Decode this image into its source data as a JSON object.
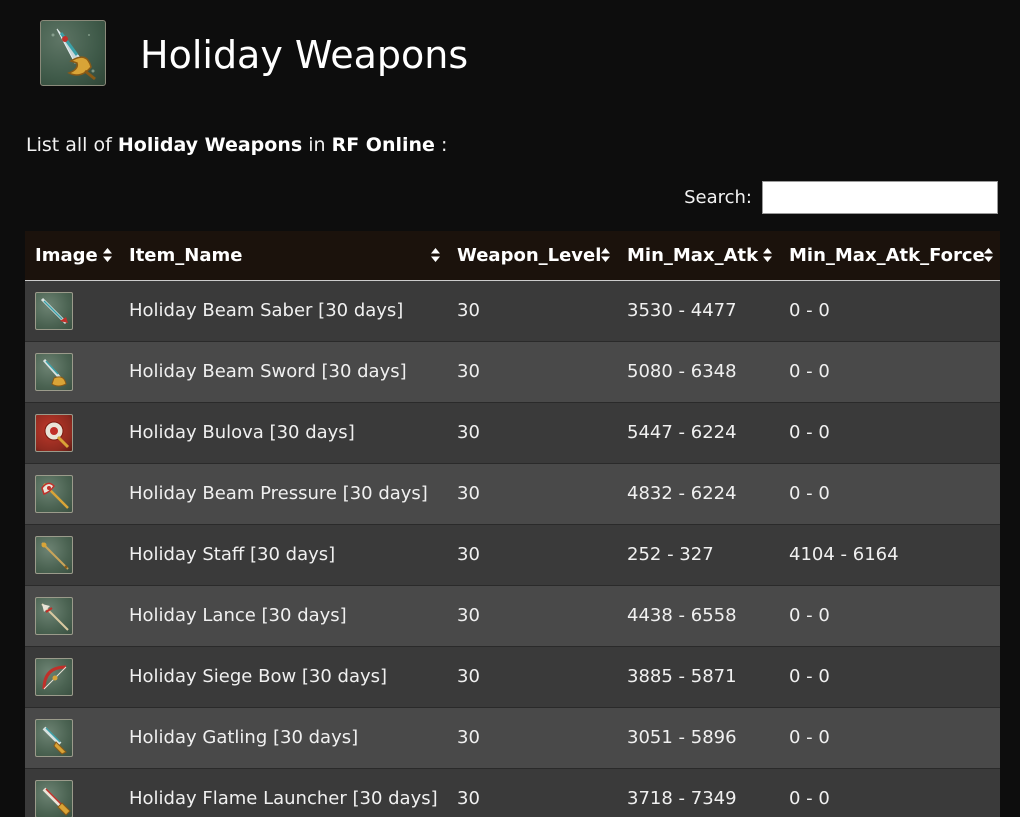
{
  "header": {
    "title": "Holiday Weapons",
    "icon": "holiday-weapon-icon"
  },
  "intro": {
    "prefix": "List all of",
    "category": "Holiday Weapons",
    "middle": "in",
    "game": "RF Online",
    "suffix": ":"
  },
  "search": {
    "label": "Search:",
    "value": ""
  },
  "table": {
    "columns": [
      "Image",
      "Item_Name",
      "Weapon_Level",
      "Min_Max_Atk",
      "Min_Max_Atk_Force"
    ],
    "rows": [
      {
        "icon": "beam-saber-icon",
        "name": "Holiday Beam Saber [30 days]",
        "level": "30",
        "atk": "3530 - 4477",
        "force": "0 - 0"
      },
      {
        "icon": "beam-sword-icon",
        "name": "Holiday Beam Sword [30 days]",
        "level": "30",
        "atk": "5080 - 6348",
        "force": "0 - 0"
      },
      {
        "icon": "bulova-icon",
        "name": "Holiday Bulova [30 days]",
        "level": "30",
        "atk": "5447 - 6224",
        "force": "0 - 0"
      },
      {
        "icon": "beam-pressure-icon",
        "name": "Holiday Beam Pressure [30 days]",
        "level": "30",
        "atk": "4832 - 6224",
        "force": "0 - 0"
      },
      {
        "icon": "staff-icon",
        "name": "Holiday Staff [30 days]",
        "level": "30",
        "atk": "252 - 327",
        "force": "4104 - 6164"
      },
      {
        "icon": "lance-icon",
        "name": "Holiday Lance [30 days]",
        "level": "30",
        "atk": "4438 - 6558",
        "force": "0 - 0"
      },
      {
        "icon": "siege-bow-icon",
        "name": "Holiday Siege Bow [30 days]",
        "level": "30",
        "atk": "3885 - 5871",
        "force": "0 - 0"
      },
      {
        "icon": "gatling-icon",
        "name": "Holiday Gatling [30 days]",
        "level": "30",
        "atk": "3051 - 5896",
        "force": "0 - 0"
      },
      {
        "icon": "flame-launcher-icon",
        "name": "Holiday Flame Launcher [30 days]",
        "level": "30",
        "atk": "3718 - 7349",
        "force": "0 - 0"
      }
    ]
  }
}
